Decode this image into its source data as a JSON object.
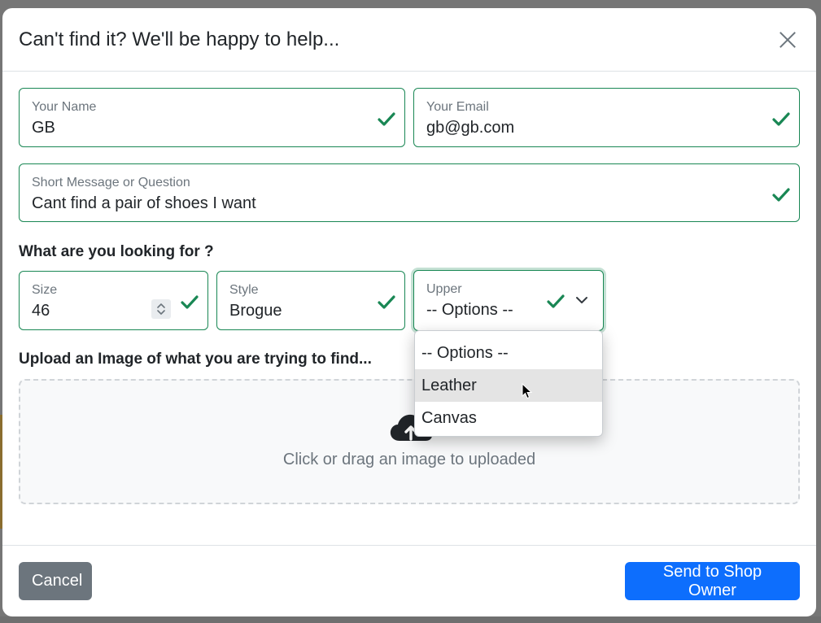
{
  "modal": {
    "title": "Can't find it? We'll be happy to help..."
  },
  "fields": {
    "name": {
      "label": "Your Name",
      "value": "GB"
    },
    "email": {
      "label": "Your Email",
      "value": "gb@gb.com"
    },
    "message": {
      "label": "Short Message or Question",
      "value": "Cant find a pair of shoes I want"
    }
  },
  "looking_for": {
    "heading": "What are you looking for ?",
    "size": {
      "label": "Size",
      "value": "46"
    },
    "style": {
      "label": "Style",
      "value": "Brogue"
    },
    "upper": {
      "label": "Upper",
      "value": "-- Options --",
      "options": [
        "-- Options --",
        "Leather",
        "Canvas"
      ],
      "hovered_option": "Leather"
    }
  },
  "upload": {
    "heading": "Upload an Image of what you are trying to find...",
    "prompt": "Click or drag an image to uploaded"
  },
  "footer": {
    "cancel_label": "Cancel",
    "send_label": "Send to Shop Owner"
  },
  "colors": {
    "valid_border": "#198754",
    "primary": "#0d6efd",
    "secondary": "#6c757d"
  },
  "icons": {
    "close": "close-icon",
    "check": "checkmark-icon",
    "chevron": "chevron-down-icon",
    "upload": "cloud-upload-icon",
    "spinner": "number-spinner-icon"
  }
}
